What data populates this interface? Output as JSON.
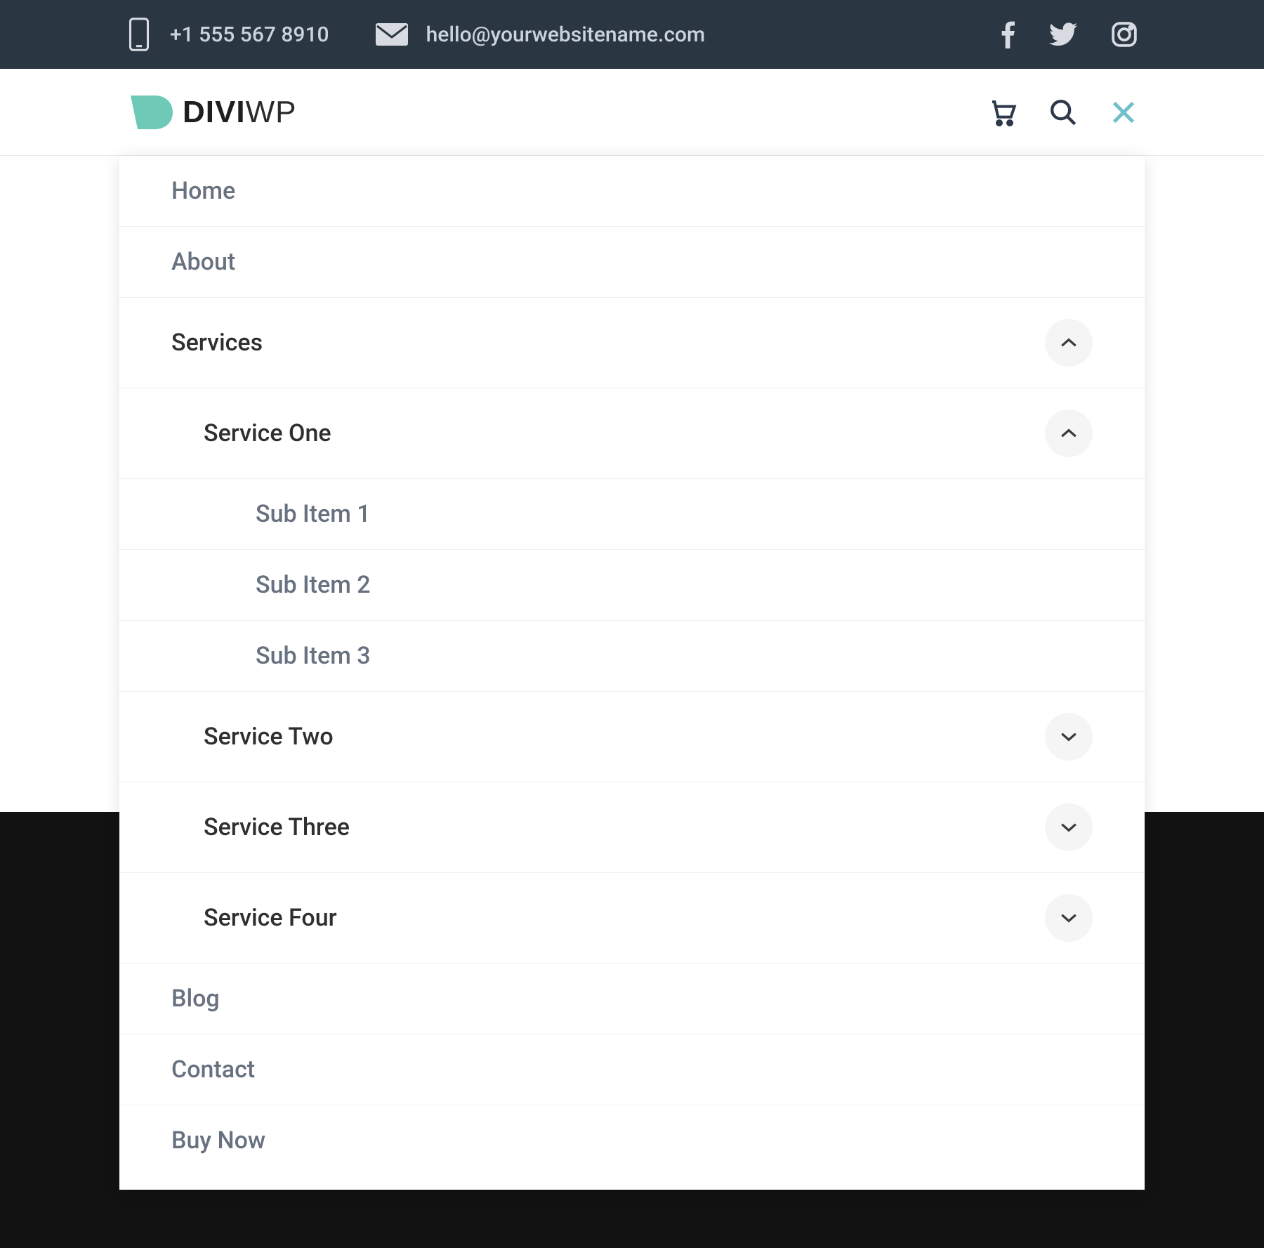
{
  "topbar": {
    "phone": "+1 555 567 8910",
    "email": "hello@yourwebsitename.com"
  },
  "logo": {
    "part1": "DIVI",
    "part2": "WP"
  },
  "menu": {
    "home": "Home",
    "about": "About",
    "services": "Services",
    "service_one": "Service One",
    "sub_item_1": "Sub Item 1",
    "sub_item_2": "Sub Item 2",
    "sub_item_3": "Sub Item 3",
    "service_two": "Service Two",
    "service_three": "Service Three",
    "service_four": "Service Four",
    "blog": "Blog",
    "contact": "Contact",
    "buy_now": "Buy Now"
  }
}
